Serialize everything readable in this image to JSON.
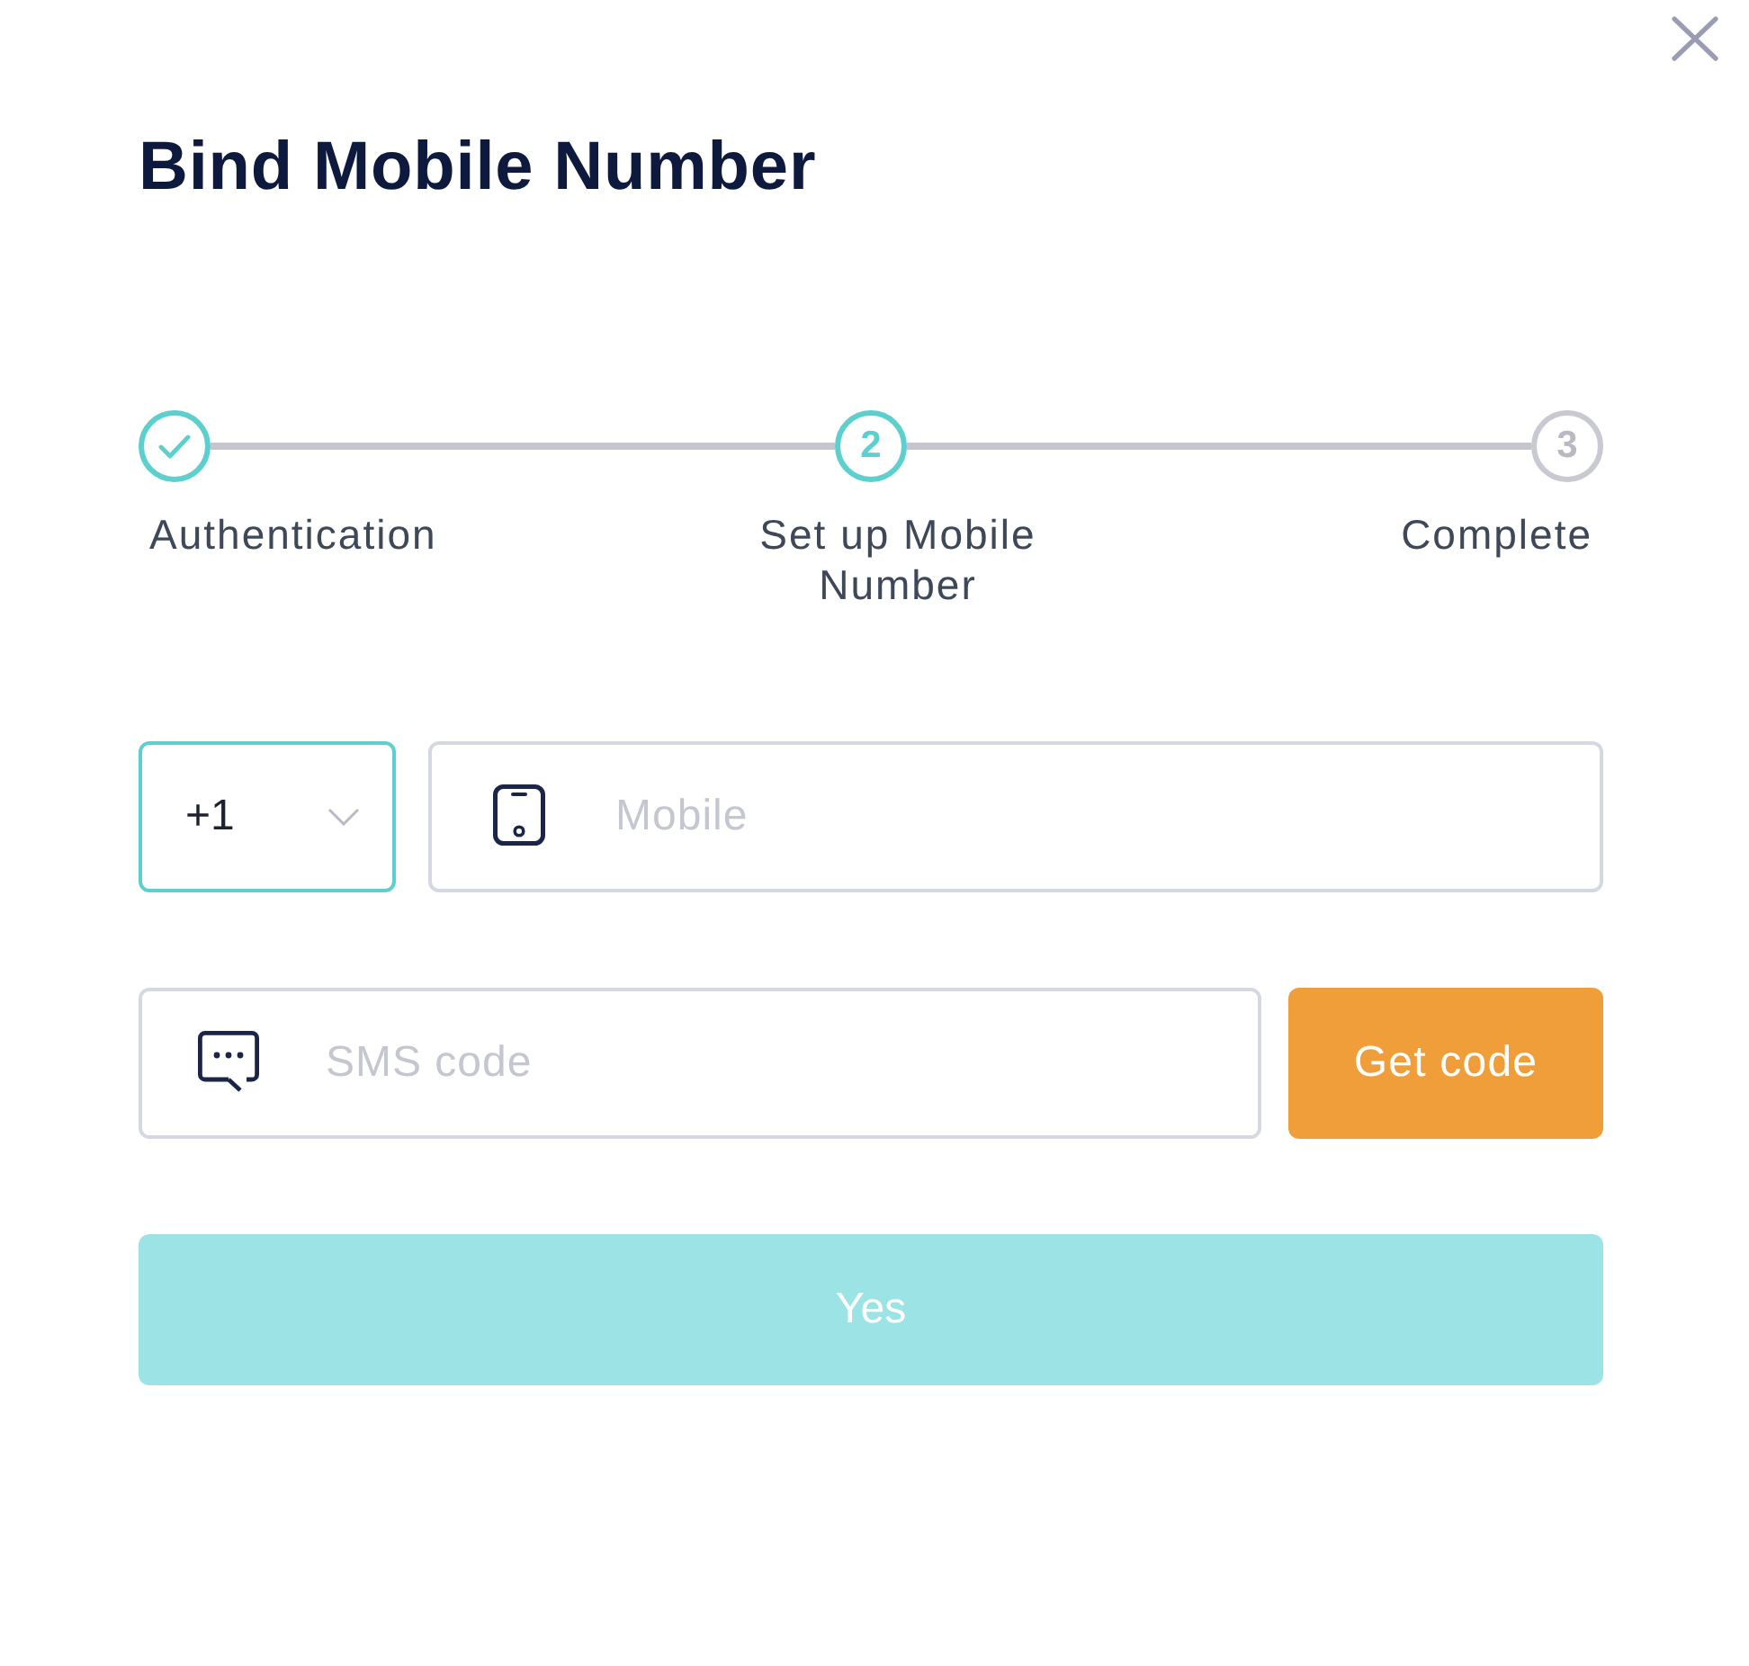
{
  "dialog": {
    "title": "Bind Mobile Number"
  },
  "steps": [
    {
      "label": "Authentication",
      "completed": true,
      "selected": false
    },
    {
      "label": "Set up Mobile Number",
      "marker": "2",
      "completed": false,
      "selected": true
    },
    {
      "label": "Complete",
      "marker": "3",
      "completed": false,
      "selected": false
    }
  ],
  "form": {
    "country_code": {
      "value": "+1",
      "focused": true
    },
    "mobile": {
      "placeholder": "Mobile",
      "focused": false
    },
    "sms_code": {
      "placeholder": "SMS code",
      "focused": false
    },
    "get_code_button": {
      "label": "Get code"
    },
    "submit_button": {
      "label": "Yes",
      "disabled": true
    }
  }
}
